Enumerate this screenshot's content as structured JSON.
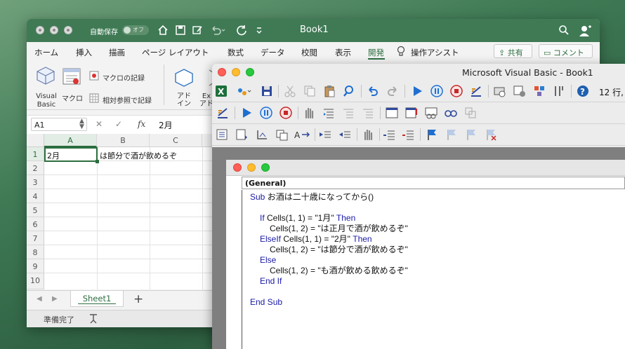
{
  "excel": {
    "autosave_label": "自動保存",
    "autosave_state": "オフ",
    "book_title": "Book1",
    "ribbon_tabs": [
      "ホーム",
      "挿入",
      "描画",
      "ページ レイアウト",
      "数式",
      "データ",
      "校閲",
      "表示",
      "開発"
    ],
    "assist_label": "操作アシスト",
    "share_label": "共有",
    "comment_label": "コメント",
    "ribbon": {
      "vb_label": "Visual\nBasic",
      "macro_label": "マクロ",
      "record_macro": "マクロの記録",
      "relative_ref": "相対参照で記録",
      "addin_label": "アド\nイン",
      "ext_label": "Ex\nアド"
    },
    "name_box": "A1",
    "formula_value": "2月",
    "columns": [
      "A",
      "B",
      "C"
    ],
    "rows": [
      "1",
      "2",
      "3",
      "4",
      "5",
      "6",
      "7",
      "8",
      "9",
      "10"
    ],
    "cells": {
      "A1": "2月",
      "B1": "は節分で酒が飲めるぞ"
    },
    "sheet_tab": "Sheet1",
    "status": "準備完了"
  },
  "vba": {
    "title": "Microsoft Visual Basic - Book1",
    "position": "12 行,",
    "proc_combo": "(General)",
    "code_lines": [
      {
        "kw": "Sub",
        "text": " お酒は二十歳になってから()",
        "indent": 0
      },
      {
        "kw": "",
        "text": "",
        "indent": 0
      },
      {
        "kw": "If",
        "text": " Cells(1, 1) = \"1月\" ",
        "kw2": "Then",
        "indent": 1
      },
      {
        "kw": "",
        "text": "Cells(1, 2) = \"は正月で酒が飲めるぞ\"",
        "indent": 2
      },
      {
        "kw": "ElseIf",
        "text": " Cells(1, 1) = \"2月\" ",
        "kw2": "Then",
        "indent": 1
      },
      {
        "kw": "",
        "text": "Cells(1, 2) = \"は節分で酒が飲めるぞ\"",
        "indent": 2
      },
      {
        "kw": "Else",
        "text": "",
        "indent": 1
      },
      {
        "kw": "",
        "text": "Cells(1, 2) = \"も酒が飲める飲めるぞ\"",
        "indent": 2
      },
      {
        "kw": "End If",
        "text": "",
        "indent": 1
      },
      {
        "kw": "",
        "text": "",
        "indent": 0
      },
      {
        "kw": "End Sub",
        "text": "",
        "indent": 0
      }
    ]
  },
  "colors": {
    "excel_green": "#3f7a55",
    "keyword_blue": "#1a1aa6",
    "play_blue": "#1f6fd0",
    "stop_red": "#c62828"
  }
}
